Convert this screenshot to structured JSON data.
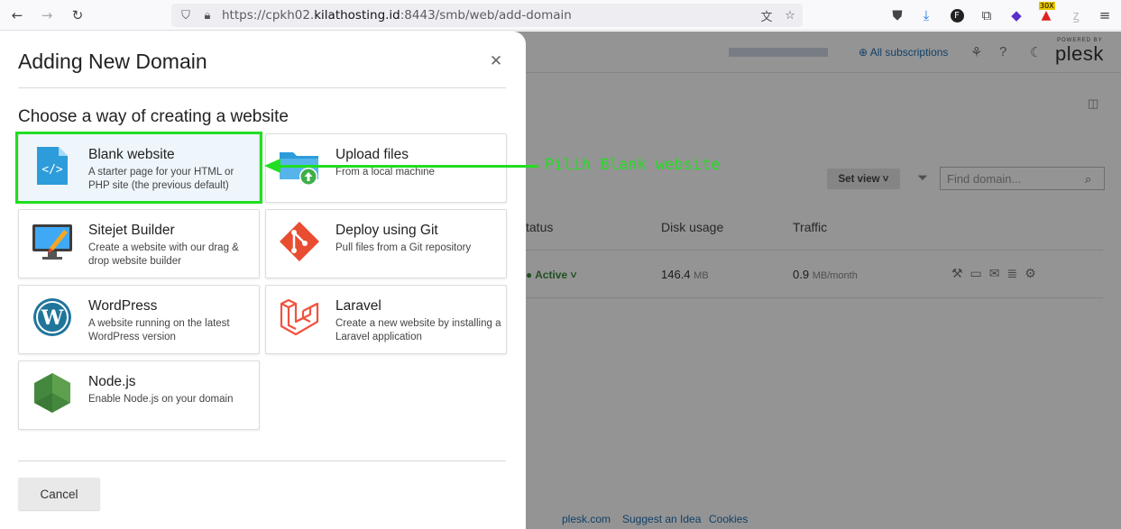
{
  "browser": {
    "url_prefix": "https://cpkh02.",
    "url_host": "kilathosting.id",
    "url_suffix": ":8443/smb/web/add-domain",
    "extension_badge": "30X"
  },
  "plesk_bg": {
    "subscriptions_label": "All subscriptions",
    "powered_by": "POWERED BY",
    "logo": "plesk",
    "set_view_label": "Set view",
    "find_placeholder": "Find domain...",
    "columns": [
      "tatus",
      "Disk usage",
      "Traffic"
    ],
    "row": {
      "status": "Active",
      "disk_value": "146.4",
      "disk_unit": "MB",
      "traffic_value": "0.9",
      "traffic_unit": "MB/month"
    },
    "footer_links": [
      "plesk.com",
      "Suggest an Idea",
      "Cookies"
    ]
  },
  "modal": {
    "title": "Adding New Domain",
    "section_title": "Choose a way of creating a website",
    "cancel_label": "Cancel",
    "options": [
      {
        "title": "Blank website",
        "desc": "A starter page for your HTML or PHP site (the previous default)",
        "icon": "blank-website-icon"
      },
      {
        "title": "Upload files",
        "desc": "From a local machine",
        "icon": "upload-folder-icon"
      },
      {
        "title": "Sitejet Builder",
        "desc": "Create a website with our drag & drop website builder",
        "icon": "sitejet-icon"
      },
      {
        "title": "Deploy using Git",
        "desc": "Pull files from a Git repository",
        "icon": "git-icon"
      },
      {
        "title": "WordPress",
        "desc": "A website running on the latest WordPress version",
        "icon": "wordpress-icon"
      },
      {
        "title": "Laravel",
        "desc": "Create a new website by installing a Laravel application",
        "icon": "laravel-icon"
      },
      {
        "title": "Node.js",
        "desc": "Enable Node.js on your domain",
        "icon": "nodejs-icon"
      }
    ]
  },
  "annotation": {
    "text": "Pilih Blank website",
    "color": "#22dd22"
  }
}
